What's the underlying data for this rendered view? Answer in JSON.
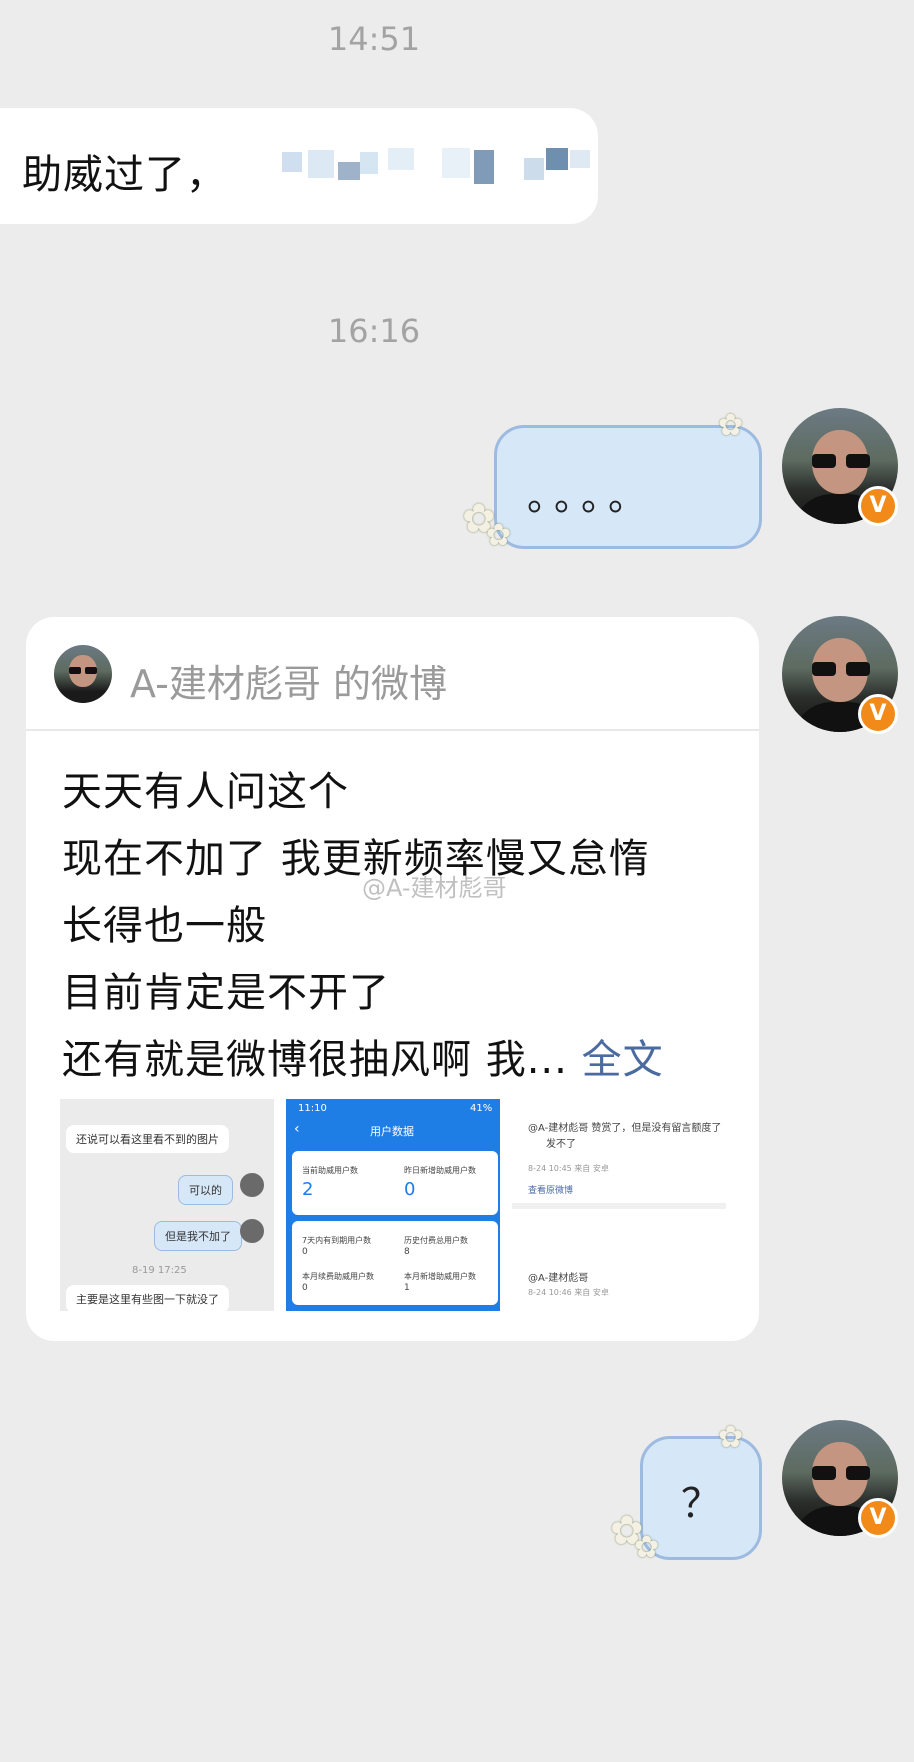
{
  "timestamps": [
    "14:51",
    "16:16"
  ],
  "messages": {
    "received_1": "助威过了，",
    "sent_1": "。。。。",
    "sent_2": "？"
  },
  "shared_post": {
    "header": "A-建材彪哥 的微博",
    "lines": [
      "天天有人问这个",
      "现在不加了 我更新频率慢又怠惰",
      "长得也一般",
      "目前肯定是不开了",
      "还有就是微博很抽风啊 我..."
    ],
    "full_text_link": "全文",
    "watermark": "@A-建材彪哥"
  },
  "thumb1": {
    "b1": "还说可以看这里看不到的图片",
    "b2": "可以的",
    "b3": "但是我不加了",
    "time": "8-19 17:25",
    "b4": "主要是这里有些图一下就没了"
  },
  "thumb2": {
    "status_time": "11:10",
    "status_right": "41%",
    "title": "用户数据",
    "l1": "当前助威用户数",
    "v1": "2",
    "l2": "昨日新增助威用户数",
    "v2": "0",
    "l3": "7天内有到期用户数",
    "v3": "0",
    "l4": "历史付费总用户数",
    "v4": "8",
    "l5": "本月续费助威用户数",
    "v5": "0",
    "l6": "本月新增助威用户数",
    "v6": "1"
  },
  "thumb3": {
    "c1": "@A-建材彪哥 赞赏了，但是没有留言额度了",
    "c1b": "发不了",
    "c1time": "8-24 10:45 来自 安卓",
    "link": "查看原微博",
    "c2": "@A-建材彪哥",
    "c2time": "8-24 10:46 来自 安卓"
  },
  "badge": "V"
}
